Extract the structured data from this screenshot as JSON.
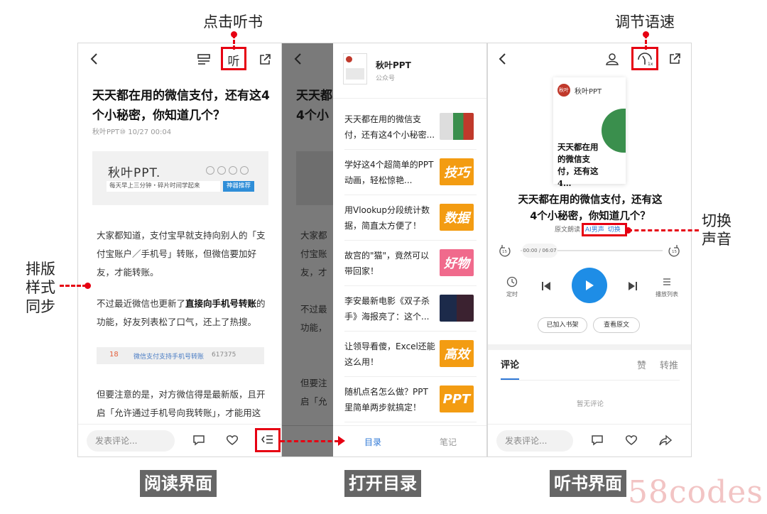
{
  "annotations": {
    "listen_click": "点击听书",
    "speed_adjust": "调节语速",
    "layout_sync": "排版\n样式\n同步",
    "switch_voice": "切换\n声音"
  },
  "captions": {
    "reading": "阅读界面",
    "toc": "打开目录",
    "listening": "听书界面"
  },
  "watermark": "58codes",
  "reader": {
    "listen_icon_text": "听",
    "title": "天天都在用的微信支付，还有这4个小秘密，你知道几个？",
    "meta": "秋叶PPT⑩ 10/27 00:04",
    "banner_logo": "秋叶PPT.",
    "banner_tagline": "每天早上三分钟・碎片时间学起来",
    "banner_button": "神器推荐",
    "para1": "大家都知道，支付宝早就支持向别人的「支付宝账户／手机号」转账，但微信要加好友，才能转账。",
    "para2_a": "不过最近微信也更新了",
    "para2_b": "直接向手机号转账",
    "para2_c": "的功能，好友列表松了口气，还上了热搜。",
    "hot_rank": "18",
    "hot_text": "微信支付支持手机号转账",
    "hot_count": "617375",
    "para3": "但要注意的是，对方微信得是最新版，且开启「允许通过手机号向我转账」，才能用这",
    "comment_placeholder": "发表评论..."
  },
  "toc": {
    "account_name": "秋叶PPT",
    "account_type": "公众号",
    "items": [
      {
        "text": "天天都在用的微信支付，还有这4个小秘密...",
        "thumb": ""
      },
      {
        "text": "学好这4个超简单的PPT动画，轻松惊艳...",
        "thumb": "技巧"
      },
      {
        "text": "用Vlookup分段统计数据，简直太方便了！",
        "thumb": "数据"
      },
      {
        "text": "故宫的\"猫\"，竟然可以带回家！",
        "thumb": "好物"
      },
      {
        "text": "李安最新电影《双子杀手》海报亮了：这个...",
        "thumb": ""
      },
      {
        "text": "让领导看傻，Excel还能这么用！",
        "thumb": "高效"
      },
      {
        "text": "随机点名怎么做？PPT里简单两步就搞定！",
        "thumb": "PPT"
      }
    ],
    "tab_catalog": "目录",
    "tab_notes": "笔记"
  },
  "player": {
    "brand": "秋叶PPT",
    "cover_text": "天天都在用的微信支付，还有这4…",
    "title": "天天都在用的微信支付，还有这4个小秘密，你知道几个？",
    "voice_prefix": "原文朗读",
    "voice_name": "AI男声",
    "voice_switch": "切换",
    "time": "00:00 / 06:07",
    "progress": 0,
    "rewind_label": "15",
    "forward_label": "15",
    "timer_label": "定时",
    "playlist_label": "播放列表",
    "btn_added": "已加入书架",
    "btn_original": "查看原文",
    "tab_comments": "评论",
    "tab_likes": "赞",
    "tab_shares": "转推",
    "no_comments": "暂无评论",
    "comment_placeholder": "发表评论..."
  }
}
